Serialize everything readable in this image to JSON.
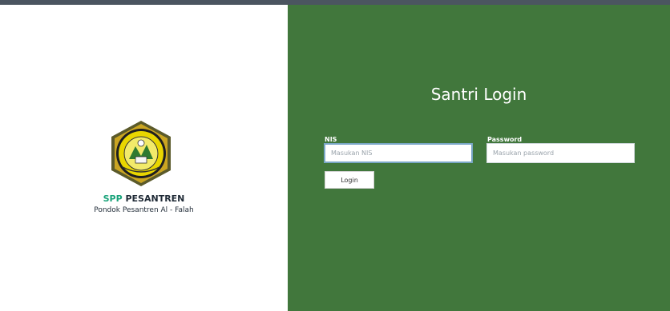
{
  "brand": {
    "title_accent": "SPP",
    "title_rest": " PESANTREN",
    "subtitle": "Pondok Pesantren Al - Falah",
    "logo_icon": "school-emblem-logo",
    "accent_color": "#19a37a"
  },
  "login": {
    "title": "Santri Login",
    "background_color": "#41773c",
    "nis": {
      "label": "NIS",
      "placeholder": "Masukan NIS",
      "value": ""
    },
    "password": {
      "label": "Password",
      "placeholder": "Masukan password",
      "value": ""
    },
    "submit_label": "Login"
  }
}
